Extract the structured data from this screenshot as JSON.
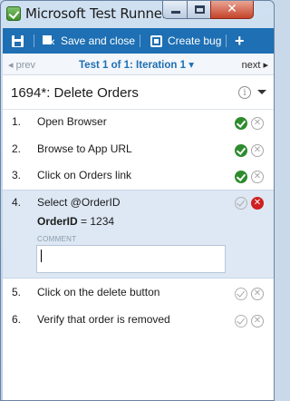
{
  "window": {
    "title": "Microsoft Test Runner -",
    "minimize_glyph": "",
    "maximize_glyph": "",
    "close_glyph": "✕"
  },
  "toolbar": {
    "save_and_close_label": "Save and close",
    "create_bug_label": "Create bug",
    "add_label": "+"
  },
  "pager": {
    "prev_label": "◂ prev",
    "iteration_label": "Test 1 of 1: Iteration 1 ▾",
    "next_label": "next ▸"
  },
  "test_case": {
    "title": "1694*: Delete Orders",
    "info_glyph": "i"
  },
  "steps": [
    {
      "number": "1.",
      "text": "Open Browser",
      "status": "passed"
    },
    {
      "number": "2.",
      "text": "Browse to App URL",
      "status": "passed"
    },
    {
      "number": "3.",
      "text": "Click on Orders link",
      "status": "passed"
    },
    {
      "number": "4.",
      "text": "Select @OrderID",
      "status": "failed",
      "param_name": "OrderID",
      "param_value": "= 1234",
      "comment_label": "COMMENT",
      "comment_value": ""
    },
    {
      "number": "5.",
      "text": "Click on the delete button",
      "status": "none"
    },
    {
      "number": "6.",
      "text": "Verify that order is removed",
      "status": "none"
    }
  ],
  "colors": {
    "toolbar_bg": "#1e6fb3",
    "pass": "#2e8b2e",
    "fail": "#d01f1f",
    "active_row": "#dde8f4"
  }
}
